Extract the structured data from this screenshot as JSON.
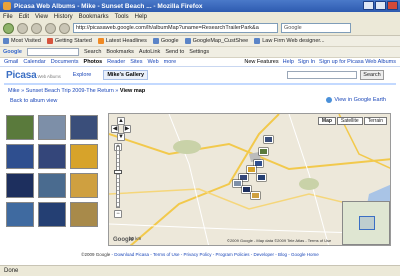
{
  "window": {
    "title": "Picasa Web Albums - Mike - Sunset Beach ... - Mozilla Firefox"
  },
  "menu": [
    "File",
    "Edit",
    "View",
    "History",
    "Bookmarks",
    "Tools",
    "Help"
  ],
  "address": {
    "url": "http://picasaweb.google.com/lh/albumMap?uname=ResearchTrailerPark&a"
  },
  "firefox_search": {
    "placeholder": "Google"
  },
  "bookmarks": [
    "Most Visited",
    "Getting Started",
    "Latest Headlines",
    "Google",
    "GoogleMap_CustShee",
    "Law Firm Web designer..."
  ],
  "google_toolbar": {
    "logo": "Google",
    "items": [
      "Search",
      "Bookmarks",
      "AutoLink",
      "Send to",
      "Settings"
    ]
  },
  "google_bar": {
    "links": [
      "Gmail",
      "Calendar",
      "Documents",
      "Photos",
      "Reader",
      "Sites",
      "Web",
      "more"
    ],
    "active": "Photos",
    "right_links": [
      "New Features",
      "Help",
      "Sign In",
      "Sign up for Picasa Web Albums"
    ]
  },
  "picasa": {
    "logo": "Picasa",
    "logo_sub": "Web Albums",
    "tabs": [
      "Explore",
      "Mike's Gallery"
    ],
    "search_button": "Search"
  },
  "breadcrumb": {
    "path": "Mike » Sunset Beach Trip 2009-The Return »",
    "current": "View map"
  },
  "back_link": "Back to album view",
  "earth_link": "View in Google Earth",
  "thumbnails": [
    {
      "bg": "#5a7a3c"
    },
    {
      "bg": "#7d8fa8"
    },
    {
      "bg": "#3a4e7a"
    },
    {
      "bg": "#2f4f8f"
    },
    {
      "bg": "#34467a"
    },
    {
      "bg": "#d7a32a"
    },
    {
      "bg": "#1d2f5e"
    },
    {
      "bg": "#4a6b8f"
    },
    {
      "bg": "#cfa040"
    },
    {
      "bg": "#3f6aa0"
    },
    {
      "bg": "#243f73"
    },
    {
      "bg": "#a88a4a"
    }
  ],
  "map": {
    "type_buttons": [
      "Map",
      "Satellite",
      "Terrain"
    ],
    "selected_type": "Map",
    "scale": "20 km",
    "copyright": "©2009 Google - Map data ©2009 Tele Atlas - Terms of Use",
    "logo": "Google"
  },
  "footer": {
    "copyright": "©2009 Google",
    "links": [
      "Download Picasa",
      "Terms of Use",
      "Privacy Policy",
      "Program Policies",
      "Developer",
      "Blog",
      "Google Home"
    ]
  },
  "status": "Done"
}
